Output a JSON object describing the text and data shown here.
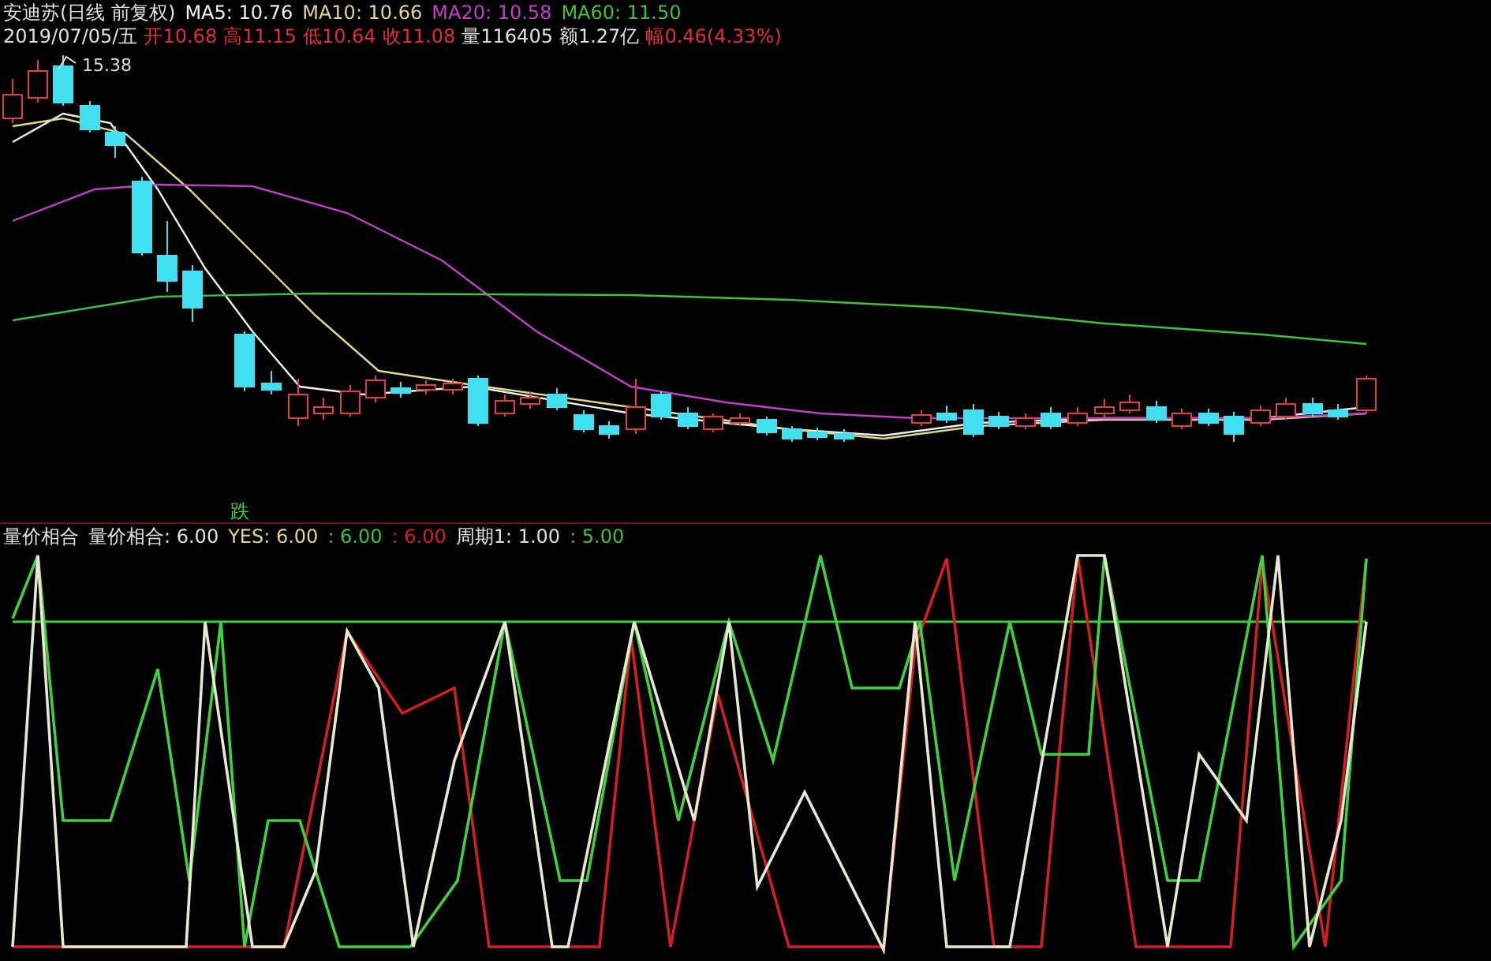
{
  "stock_header": {
    "title": "安迪苏(日线 前复权)",
    "moving_averages": [
      {
        "label": "MA5: 10.76",
        "color": "#f0f0f0"
      },
      {
        "label": "MA10: 10.66",
        "color": "#e0d890"
      },
      {
        "label": "MA20: 10.58",
        "color": "#c040c8"
      },
      {
        "label": "MA60: 11.50",
        "color": "#40c040"
      }
    ]
  },
  "quote": {
    "date": "2019/07/05/五",
    "fields": [
      {
        "text": "开10.68",
        "color": "#e03030"
      },
      {
        "text": "高11.15",
        "color": "#e03030"
      },
      {
        "text": "低10.64",
        "color": "#e03030"
      },
      {
        "text": "收11.08",
        "color": "#e03030"
      },
      {
        "text": "量116405",
        "color": "#e0e0e0"
      },
      {
        "text": "额1.27亿",
        "color": "#e0e0e0"
      },
      {
        "text": "幅0.46(4.33%)",
        "color": "#e03030"
      }
    ]
  },
  "price_chart": {
    "high_marker": "15.38",
    "signal_label": "跌"
  },
  "indicator": {
    "name": "量价相合",
    "values": [
      {
        "text": "量价相合: 6.00",
        "color": "#e0e0e0"
      },
      {
        "text": "YES: 6.00",
        "color": "#e0d890"
      },
      {
        "text": ": 6.00",
        "color": "#40c040"
      },
      {
        "text": ": 6.00",
        "color": "#d02020"
      },
      {
        "text": "周期1: 1.00",
        "color": "#e0e0e0"
      },
      {
        "text": ": 5.00",
        "color": "#40c040"
      }
    ]
  }
}
